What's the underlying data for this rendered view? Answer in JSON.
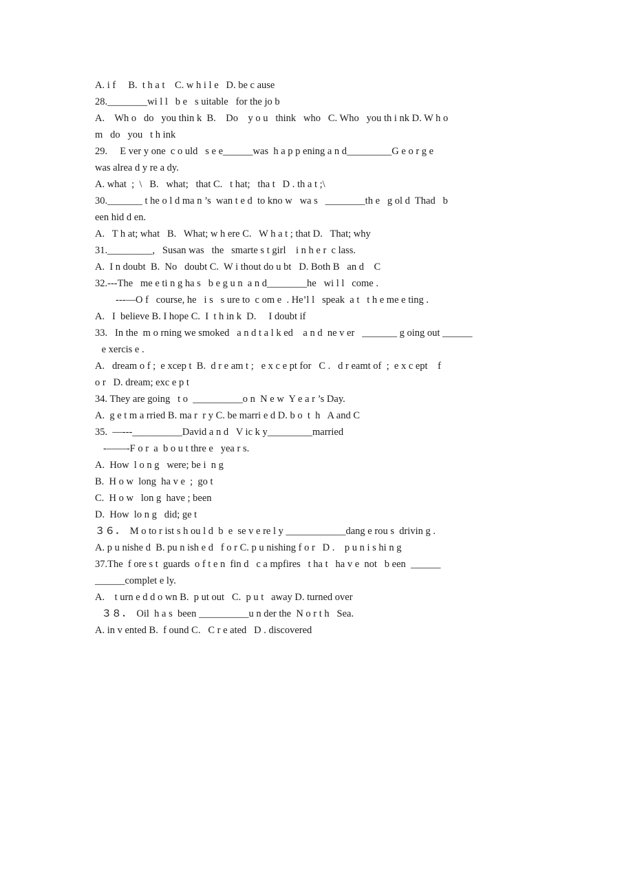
{
  "document": {
    "type": "scanned-worksheet",
    "subject": "English grammar multiple choice",
    "background_color": "#ffffff",
    "text_color": "#1a1a1a",
    "question_range": "28-38"
  },
  "lines": [
    {
      "id": "l01",
      "indent": "none",
      "text": "A. i f     B.  t h a t    C. w h i l e   D. be c ause"
    },
    {
      "id": "l02",
      "indent": "none",
      "text": "28.________wi l l   b e   s uitable   for the jo b"
    },
    {
      "id": "l03",
      "indent": "none",
      "text": "A.    Wh o   do   you thin k  B.    Do    y o u   think   who   C. Who   you th i nk D. W h o"
    },
    {
      "id": "l04",
      "indent": "none",
      "text": "m   do   you   t h ink"
    },
    {
      "id": "l05",
      "indent": "none",
      "text": "29.     E ver y one  c o uld   s e e______was  h a p p ening a n d_________G e o r g e"
    },
    {
      "id": "l06",
      "indent": "none",
      "text": "was alrea d y re a dy."
    },
    {
      "id": "l07",
      "indent": "none",
      "text": "A. what  ;  \\   B.   what;   that C.   t hat;   tha t   D . th a t ;\\"
    },
    {
      "id": "l08",
      "indent": "none",
      "text": "30._______ t he o l d ma n ’s  wan t e d  to kno w   wa s   ________th e   g ol d  Thad   b"
    },
    {
      "id": "l09",
      "indent": "none",
      "text": "een hid d en."
    },
    {
      "id": "l10",
      "indent": "none",
      "text": "A.   T h at; what   B.   What; w h ere C.   W h a t ; that D.   That; why"
    },
    {
      "id": "l11",
      "indent": "none",
      "text": "31._________,   Susan was   the   smarte s t girl    i n h e r  c lass."
    },
    {
      "id": "l12",
      "indent": "none",
      "text": "A.  I n doubt  B.  No   doubt C.  W i thout do u bt   D. Both B   an d    C"
    },
    {
      "id": "l13",
      "indent": "none",
      "text": "32.---The   me e ti n g ha s   b e g u n  a n d________he   wi l l   come ."
    },
    {
      "id": "l14",
      "indent": "ind-1",
      "text": "---—O f   course, he   i s   s ure to  c om e  . He’l l   speak  a t   t h e me e ting ."
    },
    {
      "id": "l15",
      "indent": "none",
      "text": "A.   I  believe B. I hope C.  I  t h in k  D.     I doubt if"
    },
    {
      "id": "l16",
      "indent": "none",
      "text": "33.   In the  m o rning we smoked   a n d t a l k ed    a n d  ne v er   _______ g oing out ______"
    },
    {
      "id": "l17",
      "indent": "ind-3",
      "text": " e xercis e ."
    },
    {
      "id": "l18",
      "indent": "none",
      "text": "A.   dream o f ;  e xcep t  B.  d r e am t ;   e x c e pt for   C .   d r eamt of  ;  e x c ept    f"
    },
    {
      "id": "l19",
      "indent": "none",
      "text": "o r   D. dream; exc e p t"
    },
    {
      "id": "l20",
      "indent": "none",
      "text": "34. They are going   t o  __________o n  N e w  Y e a r ’s Day."
    },
    {
      "id": "l21",
      "indent": "none",
      "text": "A.  g e t m a rried B. ma r  r y C. be marri e d D. b o  t  h   A and C"
    },
    {
      "id": "l22",
      "indent": "none",
      "text": "35.  —---__________David a n d   V ic k y_________married"
    },
    {
      "id": "l23",
      "indent": "ind-2",
      "text": "-——-F o r  a  b o u t thre e   yea r s."
    },
    {
      "id": "l24",
      "indent": "none",
      "text": "A.  How  l o n g   were; be i  n g"
    },
    {
      "id": "l25",
      "indent": "none",
      "text": "B.  H o w  long  ha v e  ;  go t"
    },
    {
      "id": "l26",
      "indent": "none",
      "text": "C.  H o w   lon g  have ; been"
    },
    {
      "id": "l27",
      "indent": "none",
      "text": "D.  How  lo n g   did; ge t"
    },
    {
      "id": "l28",
      "indent": "none",
      "text": "３６．  M o to r ist s h ou l d  b  e  se v e re l y ____________dang e rou s  drivin g ."
    },
    {
      "id": "l29",
      "indent": "none",
      "text": "A. p u nishe d  B. pu n ish e d   f o r C. p u nishing f o r   D .    p u n i s hi n g"
    },
    {
      "id": "l30",
      "indent": "none",
      "text": "37.The  f ore s t  guards  o f t e n  fin d   c a mpfires   t ha t   ha v e  not   b een  ______"
    },
    {
      "id": "l31",
      "indent": "none",
      "text": "______complet e ly."
    },
    {
      "id": "l32",
      "indent": "none",
      "text": "A.    t urn e d d o wn B.  p ut out   C.  p u t   away D. turned over"
    },
    {
      "id": "l33",
      "indent": "ind-3",
      "text": " ３８．  Oil  h a s  been __________u n der the  N o r t h   Sea."
    },
    {
      "id": "l34",
      "indent": "none",
      "text": "A. in v ented B.  f ound C.   C r e ated   D . discovered"
    }
  ]
}
